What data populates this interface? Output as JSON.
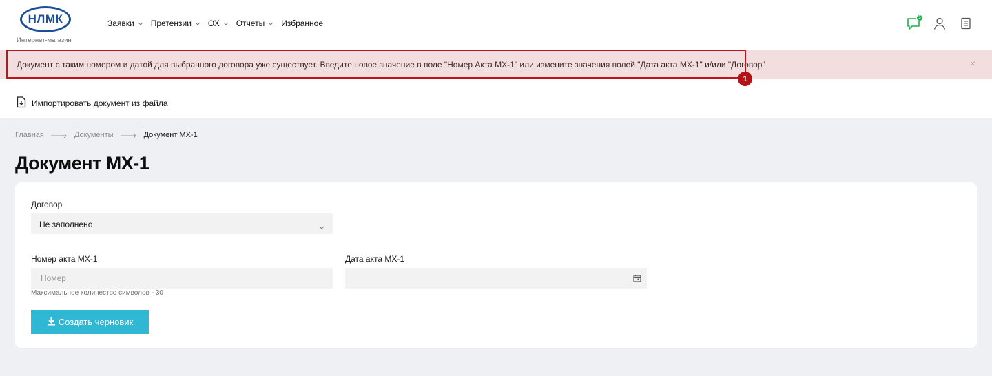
{
  "header": {
    "logo_text": "НЛМК",
    "logo_subtitle": "Интернет-магазин",
    "nav": [
      {
        "label": "Заявки",
        "has_dropdown": true
      },
      {
        "label": "Претензии",
        "has_dropdown": true
      },
      {
        "label": "ОХ",
        "has_dropdown": true
      },
      {
        "label": "Отчеты",
        "has_dropdown": true
      },
      {
        "label": "Избранное",
        "has_dropdown": false
      }
    ],
    "icons": {
      "messages": "chat-icon",
      "messages_badge": "5",
      "profile": "user-icon",
      "book": "book-icon"
    },
    "accent_color": "#1bb04a",
    "brand_color": "#1d4f96"
  },
  "alert": {
    "text": "Документ с таким номером и датой для выбранного договора уже существует. Введите новое значение в поле \"Номер Акта МХ-1\" или измените значения полей \"Дата акта МХ-1\" и/или \"Договор\"",
    "close": "×",
    "marker": "1",
    "background": "#f2dede",
    "highlight_color": "#c0141a"
  },
  "import": {
    "label": "Импортировать документ из файла"
  },
  "breadcrumb": {
    "items": [
      "Главная",
      "Документы"
    ],
    "current": "Документ МХ-1"
  },
  "page": {
    "title": "Документ МХ-1"
  },
  "form": {
    "contract_label": "Договор",
    "contract_value": "Не заполнено",
    "act_number_label": "Номер акта МХ-1",
    "act_number_value": "",
    "act_number_placeholder": "Номер",
    "act_number_hint": "Максимальное количество символов - 30",
    "act_date_label": "Дата акта МХ-1",
    "act_date_value": "",
    "submit_label": "Создать черновик",
    "submit_color": "#2fb7d4"
  }
}
